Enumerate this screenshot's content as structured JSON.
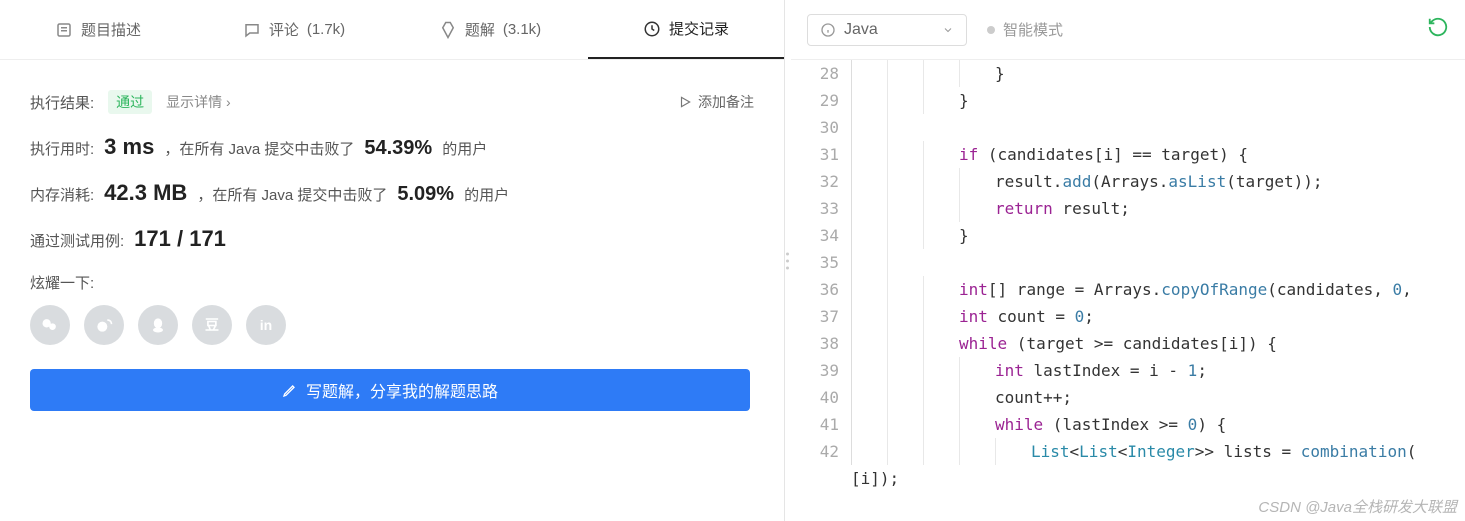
{
  "tabs": {
    "description": {
      "label": "题目描述"
    },
    "comments": {
      "label": "评论",
      "count": "(1.7k)"
    },
    "solutions": {
      "label": "题解",
      "count": "(3.1k)"
    },
    "submissions": {
      "label": "提交记录"
    }
  },
  "result": {
    "label": "执行结果:",
    "status": "通过",
    "detail_link": "显示详情 ›",
    "add_note": "添加备注"
  },
  "runtime": {
    "label": "执行用时:",
    "value": "3 ms",
    "text_before": "，在所有 Java 提交中击败了",
    "pct": "54.39%",
    "text_after": "的用户"
  },
  "memory": {
    "label": "内存消耗:",
    "value": "42.3 MB",
    "text_before": "，在所有 Java 提交中击败了",
    "pct": "5.09%",
    "text_after": "的用户"
  },
  "testcases": {
    "label": "通过测试用例:",
    "value": "171 / 171"
  },
  "share": {
    "label": "炫耀一下:",
    "icons": [
      "wechat",
      "weibo",
      "qq",
      "douban",
      "linkedin"
    ]
  },
  "write_button": "写题解，分享我的解题思路",
  "editor": {
    "language": "Java",
    "mode": "智能模式",
    "line_numbers": [
      "28",
      "29",
      "30",
      "31",
      "32",
      "33",
      "34",
      "35",
      "36",
      "37",
      "38",
      "39",
      "40",
      "41",
      "42",
      ""
    ],
    "lines_html": [
      "<span class='indent-guide first'></span><span class='indent-guide'></span><span class='indent-guide'></span><span class='indent-guide'></span>}",
      "<span class='indent-guide first'></span><span class='indent-guide'></span><span class='indent-guide'></span>}",
      "<span class='indent-guide first'></span><span class='indent-guide'></span>",
      "<span class='indent-guide first'></span><span class='indent-guide'></span><span class='indent-guide'></span><span class='kw'>if</span> (candidates[i] == target) {",
      "<span class='indent-guide first'></span><span class='indent-guide'></span><span class='indent-guide'></span><span class='indent-guide'></span>result.<span class='fn'>add</span>(Arrays.<span class='fn'>asList</span>(target));",
      "<span class='indent-guide first'></span><span class='indent-guide'></span><span class='indent-guide'></span><span class='indent-guide'></span><span class='kw'>return</span> result;",
      "<span class='indent-guide first'></span><span class='indent-guide'></span><span class='indent-guide'></span>}",
      "<span class='indent-guide first'></span><span class='indent-guide'></span>",
      "<span class='indent-guide first'></span><span class='indent-guide'></span><span class='indent-guide'></span><span class='kw'>int</span>[] range = Arrays.<span class='fn'>copyOfRange</span>(candidates, <span class='num'>0</span>,",
      "<span class='indent-guide first'></span><span class='indent-guide'></span><span class='indent-guide'></span><span class='kw'>int</span> count = <span class='num'>0</span>;",
      "<span class='indent-guide first'></span><span class='indent-guide'></span><span class='indent-guide'></span><span class='kw'>while</span> (target &gt;= candidates[i]) {",
      "<span class='indent-guide first'></span><span class='indent-guide'></span><span class='indent-guide'></span><span class='indent-guide'></span><span class='kw'>int</span> lastIndex = i - <span class='num'>1</span>;",
      "<span class='indent-guide first'></span><span class='indent-guide'></span><span class='indent-guide'></span><span class='indent-guide'></span>count++;",
      "<span class='indent-guide first'></span><span class='indent-guide'></span><span class='indent-guide'></span><span class='indent-guide'></span><span class='kw'>while</span> (lastIndex &gt;= <span class='num'>0</span>) {",
      "<span class='indent-guide first'></span><span class='indent-guide'></span><span class='indent-guide'></span><span class='indent-guide'></span><span class='indent-guide'></span><span class='cls'>List</span>&lt;<span class='cls'>List</span>&lt;<span class='cls'>Integer</span>&gt;&gt; lists = <span class='fn'>combination</span>(",
      "[i]);"
    ]
  },
  "watermark": "CSDN @Java全栈研发大联盟"
}
